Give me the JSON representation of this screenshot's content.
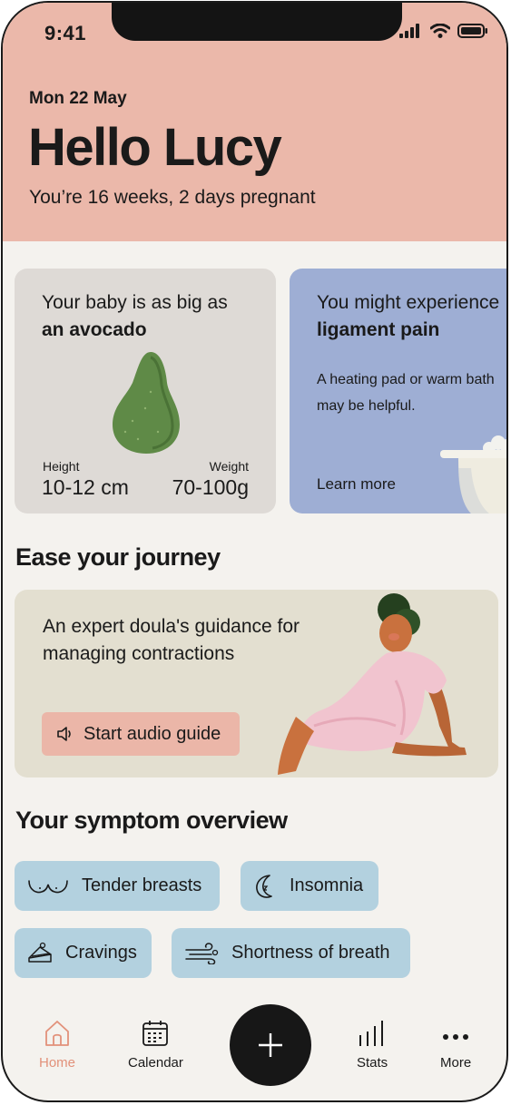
{
  "status_bar": {
    "time": "9:41",
    "icons": [
      "signal-icon",
      "wifi-icon",
      "battery-icon"
    ]
  },
  "header": {
    "date": "Mon 22 May",
    "greeting": "Hello Lucy",
    "subtitle": "You’re 16 weeks, 2 days pregnant",
    "bg_color": "#ebb8aa"
  },
  "baby_card": {
    "line1": "Your baby is as big as",
    "line2": "an avocado",
    "height_label": "Height",
    "height_value": "10-12 cm",
    "weight_label": "Weight",
    "weight_value": "70-100g"
  },
  "pain_card": {
    "line1": "You might experience",
    "line2": "ligament pain",
    "desc_line1": "A heating pad or warm bath",
    "desc_line2": "may be helpful.",
    "link": "Learn more"
  },
  "ease_section": {
    "title": "Ease your journey",
    "card_text": "An expert doula's guidance for managing contractions",
    "button_label": "Start audio guide"
  },
  "symptoms_section": {
    "title": "Your symptom overview",
    "chips": [
      {
        "label": "Tender breasts",
        "icon": "breasts-icon"
      },
      {
        "label": "Insomnia",
        "icon": "moon-icon"
      },
      {
        "label": "Cravings",
        "icon": "cake-icon"
      },
      {
        "label": "Shortness of breath",
        "icon": "wind-icon"
      }
    ]
  },
  "tab_bar": {
    "tabs": [
      {
        "label": "Home",
        "icon": "home-icon",
        "active": true
      },
      {
        "label": "Calendar",
        "icon": "calendar-icon"
      },
      {
        "label": "Stats",
        "icon": "stats-icon"
      },
      {
        "label": "More",
        "icon": "more-icon"
      }
    ],
    "add_icon": "plus-icon",
    "active_color": "#e2917a"
  }
}
